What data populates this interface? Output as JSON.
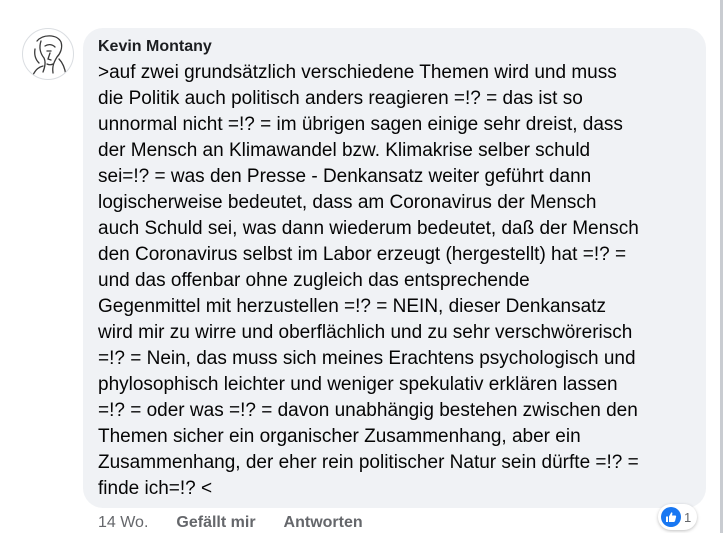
{
  "comment": {
    "author": "Kevin Montany",
    "text": ">auf zwei grundsätzlich verschiedene Themen wird und muss\ndie Politik auch politisch anders reagieren =!? = das ist so\nunnormal nicht =!? = im übrigen sagen einige sehr dreist, dass\nder Mensch an Klimawandel bzw. Klimakrise selber schuld\nsei=!? = was den Presse - Denkansatz weiter geführt dann\nlogischerweise bedeutet, dass am  Coronavirus der Mensch\nauch Schuld sei, was dann wiederum bedeutet, daß der Mensch\nden Coronavirus selbst im Labor  erzeugt (hergestellt) hat =!? =\nund  das offenbar ohne zugleich das entsprechende\nGegenmittel mit herzustellen =!? = NEIN, dieser Denkansatz\nwird mir zu wirre und oberflächlich und zu sehr verschwörerisch\n=!? = Nein, das muss sich meines Erachtens psychologisch und\nphylosophisch leichter und weniger spekulativ erklären lassen\n=!? = oder was =!? = davon unabhängig bestehen zwischen den\nThemen sicher ein organischer Zusammenhang, aber ein\nZusammenhang, der eher rein politischer Natur sein dürfte =!? =\nfinde ich=!? <",
    "timestamp": "14 Wo.",
    "like_label": "Gefällt mir",
    "reply_label": "Antworten",
    "reaction_count": "1",
    "reaction_icon": "like-thumb-icon"
  },
  "colors": {
    "bubble": "#f0f2f5",
    "like_blue": "#1877f2",
    "meta_gray": "#65676b"
  }
}
